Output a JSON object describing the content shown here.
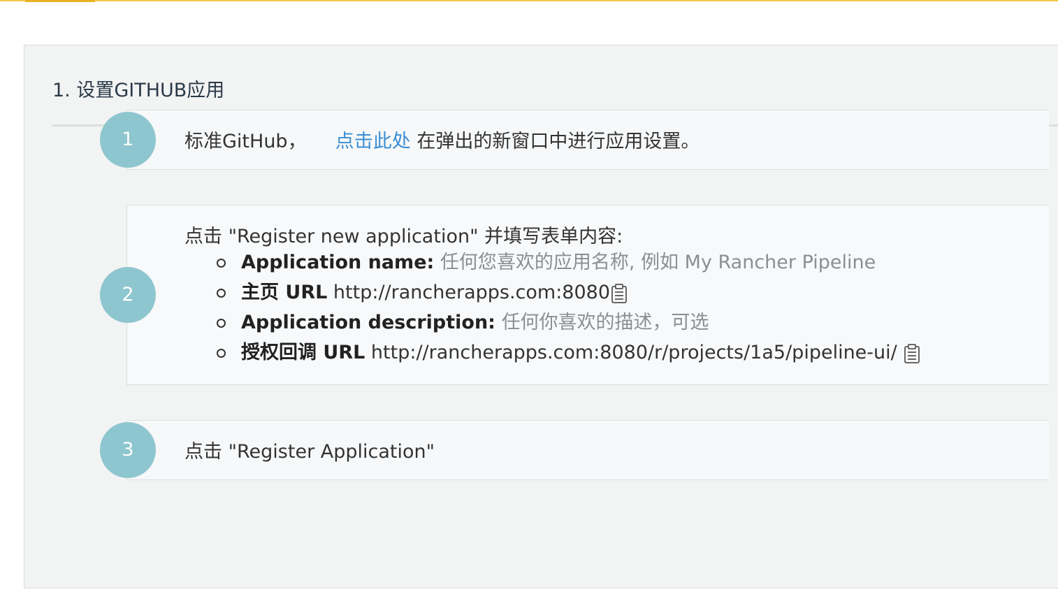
{
  "section": {
    "title": "1. 设置GITHUB应用"
  },
  "steps": [
    {
      "number": "1",
      "text_before": "标准GitHub，",
      "link_label": "点击此处",
      "text_after": "在弹出的新窗口中进行应用设置。"
    },
    {
      "number": "2",
      "intro": "点击 \"Register new application\" 并填写表单内容:",
      "fields": [
        {
          "label": "Application name:",
          "value": "任何您喜欢的应用名称, 例如 My Rancher Pipeline"
        },
        {
          "label": "主页 URL",
          "value": "http://rancherapps.com:8080"
        },
        {
          "label": "Application description:",
          "value": "任何你喜欢的描述，可选"
        },
        {
          "label": "授权回调 URL",
          "value": "http://rancherapps.com:8080/r/projects/1a5/pipeline-ui/"
        }
      ]
    },
    {
      "number": "3",
      "text": "点击 \"Register Application\""
    }
  ],
  "colors": {
    "accent": "#f2c94c",
    "step_circle": "#8ec6cf",
    "link": "#3a8ed4",
    "hint": "#8a8f93"
  },
  "icons": {
    "copy": "clipboard-icon"
  }
}
